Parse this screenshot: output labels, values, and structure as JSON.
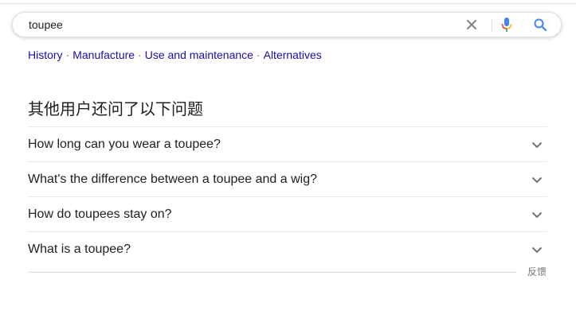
{
  "search": {
    "query": "toupee",
    "clear_icon": "close-icon",
    "voice_icon": "microphone-icon",
    "search_icon": "search-icon"
  },
  "related": {
    "links": [
      "History",
      "Manufacture",
      "Use and maintenance",
      "Alternatives"
    ],
    "separator": "·"
  },
  "paa": {
    "title": "其他用户还问了以下问题",
    "questions": [
      "How long can you wear a toupee?",
      "What's the difference between a toupee and a wig?",
      "How do toupees stay on?",
      "What is a toupee?"
    ],
    "expand_icon": "chevron-down-icon"
  },
  "footer": {
    "feedback": "反馈"
  },
  "colors": {
    "link": "#1a0dab",
    "text": "#202124",
    "secondary": "#70757a",
    "google_blue": "#4285f4",
    "google_red": "#ea4335"
  }
}
